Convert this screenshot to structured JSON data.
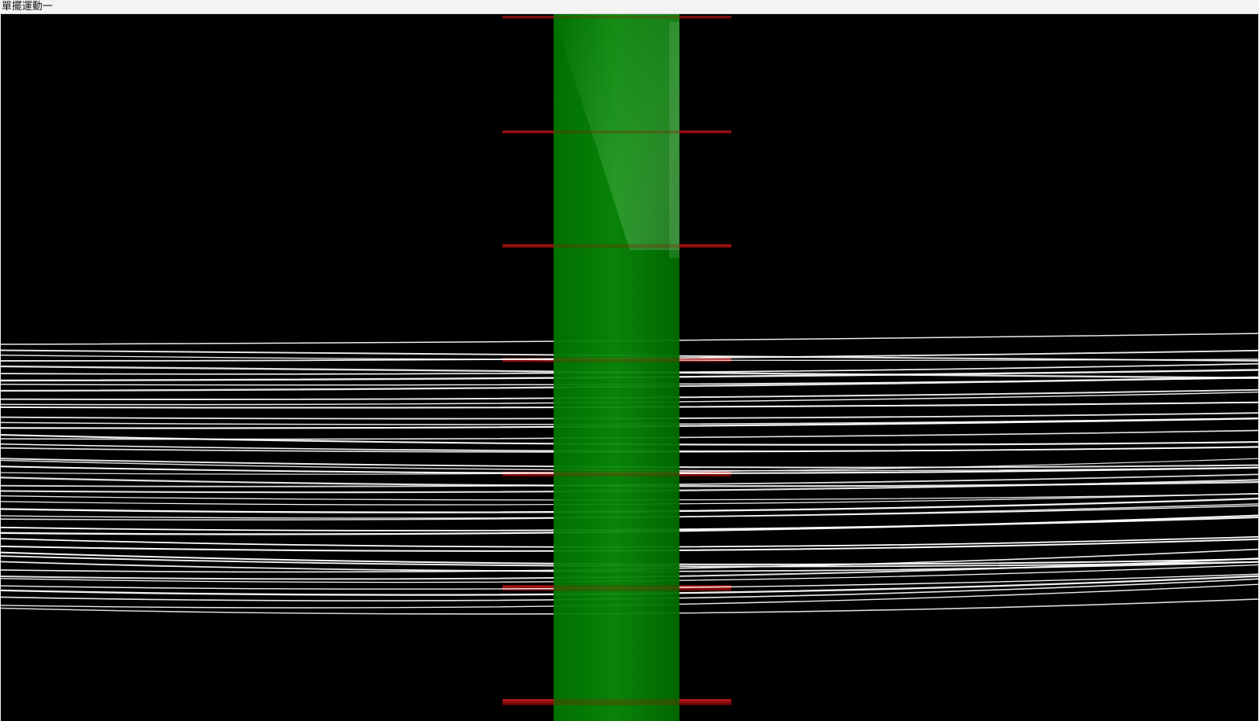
{
  "window": {
    "title": "單擺運動一"
  },
  "scene": {
    "background_color": "#000000",
    "column_color": "#007a00",
    "column_highlight_color": "#5fbf5f",
    "bar_color": "#8b0000",
    "string_color": "#ffffff"
  }
}
